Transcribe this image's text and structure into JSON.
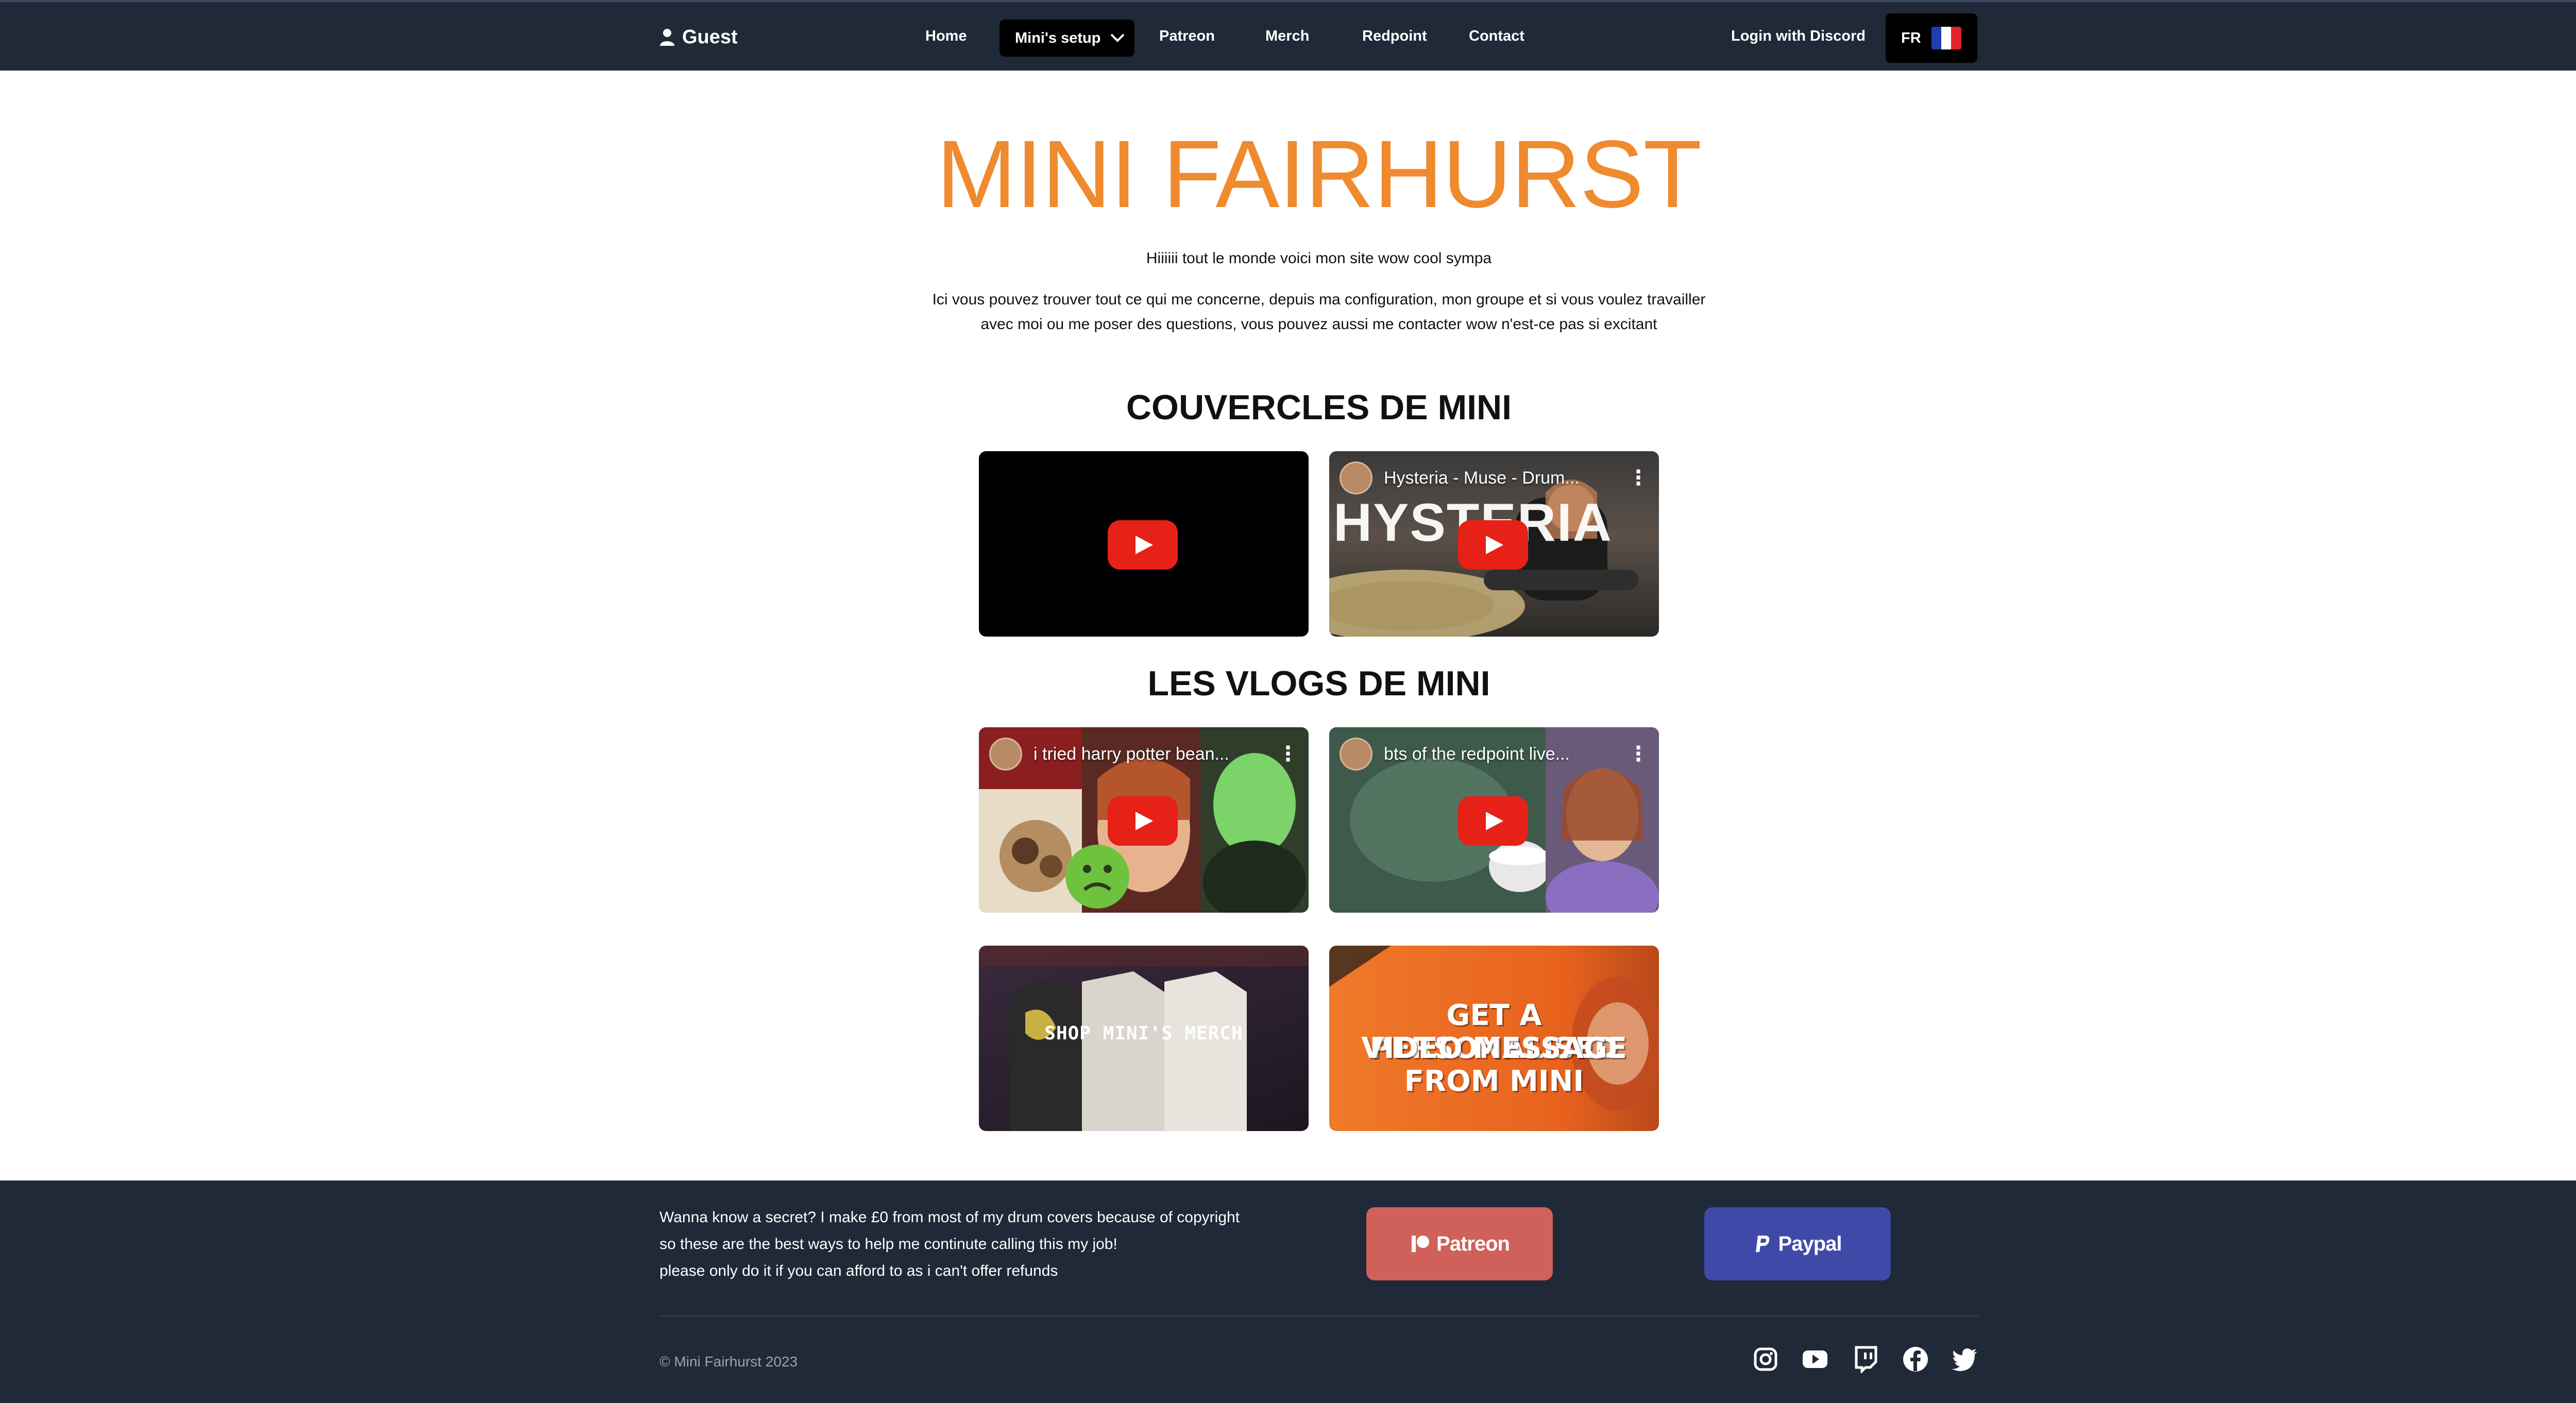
{
  "nav": {
    "user_label": "Guest",
    "links": {
      "home": "Home",
      "setup": "Mini's setup",
      "patreon": "Patreon",
      "merch": "Merch",
      "redpoint": "Redpoint",
      "contact": "Contact"
    },
    "login": "Login with Discord",
    "language": "FR",
    "flag_colors": [
      "#1f3fb0",
      "#ffffff",
      "#e3222b"
    ]
  },
  "main": {
    "title": "MINI FAIRHURST",
    "intro_line1": "Hiiiiii tout le monde voici mon site wow cool sympa",
    "intro_line2": "Ici vous pouvez trouver tout ce qui me concerne, depuis ma configuration, mon groupe et si vous voulez travailler avec moi ou me poser des questions, vous pouvez aussi me contacter wow n'est-ce pas si excitant",
    "covers_title": "COUVERCLES DE MINI",
    "vlogs_title": "LES VLOGS DE MINI",
    "covers": [
      {
        "title": ""
      },
      {
        "title": "Hysteria - Muse - Drum...",
        "overlay": "HYSTERIA"
      }
    ],
    "vlogs": [
      {
        "title": "i tried harry potter bean..."
      },
      {
        "title": "bts of the redpoint live..."
      }
    ],
    "promos": {
      "merch": "SHOP MINI'S MERCH",
      "cameo_line1": "GET A PERSONALISED",
      "cameo_line2": "VIDEO MESSAGE",
      "cameo_line3": "FROM MINI"
    }
  },
  "footer": {
    "support_text": "Wanna know a secret? I make £0 from most of my drum covers because of copyright so these are the best ways to help me continute calling this my job!",
    "support_note": "please only do it if you can afford to as i can't offer refunds",
    "patreon_label": "Patreon",
    "paypal_label": "Paypal",
    "copyright": "© Mini Fairhurst 2023",
    "colors": {
      "patreon": "#d0605a",
      "paypal": "#3f4aa8"
    },
    "social_icons": [
      "instagram-icon",
      "youtube-icon",
      "twitch-icon",
      "facebook-icon",
      "twitter-icon"
    ]
  }
}
